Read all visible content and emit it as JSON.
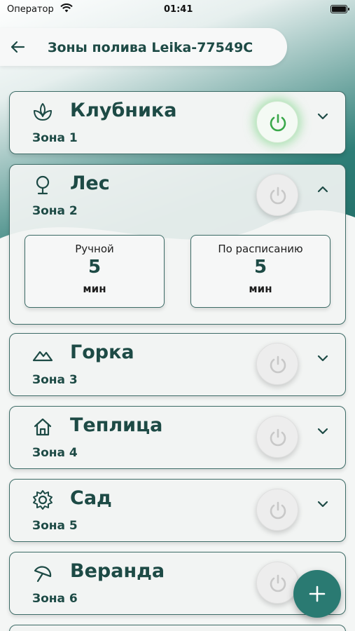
{
  "status_bar": {
    "carrier": "Оператор",
    "time": "01:41"
  },
  "header": {
    "title": "Зоны полива Leika-77549C"
  },
  "zones": [
    {
      "name": "Клубника",
      "subtitle": "Зона 1",
      "icon": "leaf-sprout-icon",
      "power_on": true,
      "expanded": false
    },
    {
      "name": "Лес",
      "subtitle": "Зона 2",
      "icon": "tree-icon",
      "power_on": false,
      "expanded": true,
      "durations": [
        {
          "label": "Ручной",
          "value": "5",
          "unit": "мин"
        },
        {
          "label": "По расписанию",
          "value": "5",
          "unit": "мин"
        }
      ]
    },
    {
      "name": "Горка",
      "subtitle": "Зона 3",
      "icon": "mountains-icon",
      "power_on": false,
      "expanded": false
    },
    {
      "name": "Теплица",
      "subtitle": "Зона 4",
      "icon": "house-icon",
      "power_on": false,
      "expanded": false
    },
    {
      "name": "Сад",
      "subtitle": "Зона 5",
      "icon": "flower-icon",
      "power_on": false,
      "expanded": false
    },
    {
      "name": "Веранда",
      "subtitle": "Зона 6",
      "icon": "umbrella-icon",
      "power_on": false,
      "expanded": false
    }
  ],
  "colors": {
    "accent": "#2a7a72",
    "text": "#1d4a45",
    "power_on_glow": "#6ed278",
    "power_icon_on": "#3aa84a",
    "power_icon_off": "#c8c8c8"
  }
}
